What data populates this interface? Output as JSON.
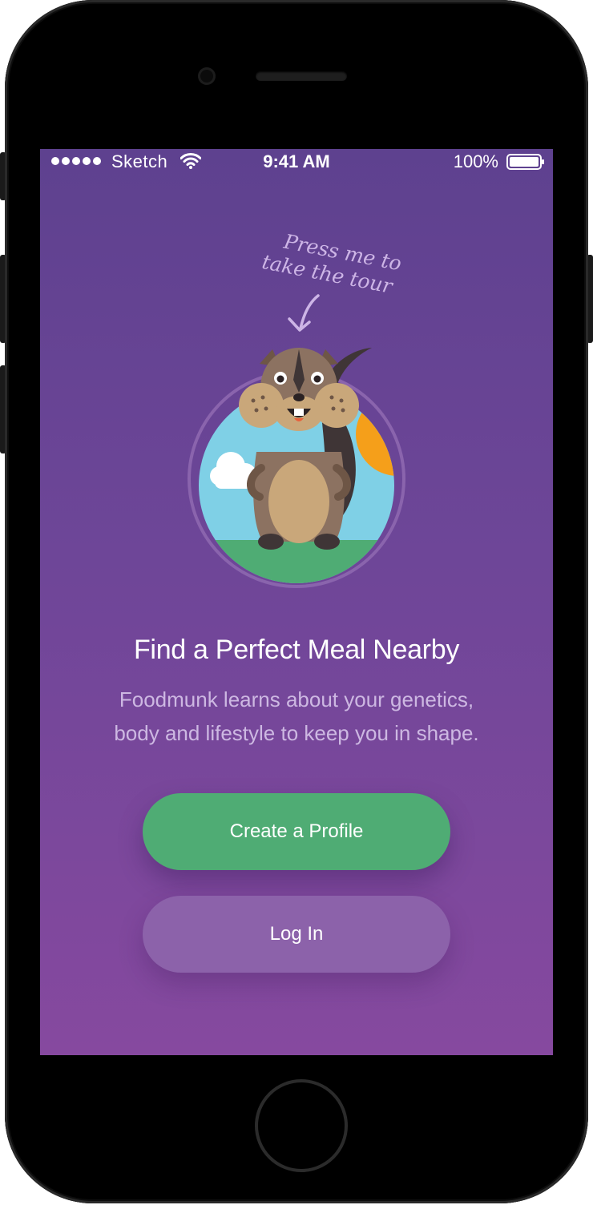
{
  "status_bar": {
    "carrier": "Sketch",
    "time": "9:41 AM",
    "battery": "100%",
    "signal_icon": "signal-dots-icon",
    "wifi_icon": "wifi-icon",
    "battery_icon": "battery-icon"
  },
  "tour_hint": {
    "line1": "Press me to",
    "line2": "take the tour",
    "arrow_icon": "arrow-down-icon"
  },
  "mascot": {
    "icon": "chipmunk-mascot-icon"
  },
  "onboarding": {
    "headline": "Find a Perfect Meal Nearby",
    "subtext_line1": "Foodmunk learns about your genetics,",
    "subtext_line2": "body and lifestyle to keep you in shape."
  },
  "actions": {
    "create_profile_label": "Create a Profile",
    "login_label": "Log In"
  },
  "colors": {
    "background_top": "#5e418f",
    "background_bottom": "#86499f",
    "primary_button": "#4fac74",
    "secondary_button": "#8c62aa",
    "hint_text": "#cdb5e6"
  }
}
